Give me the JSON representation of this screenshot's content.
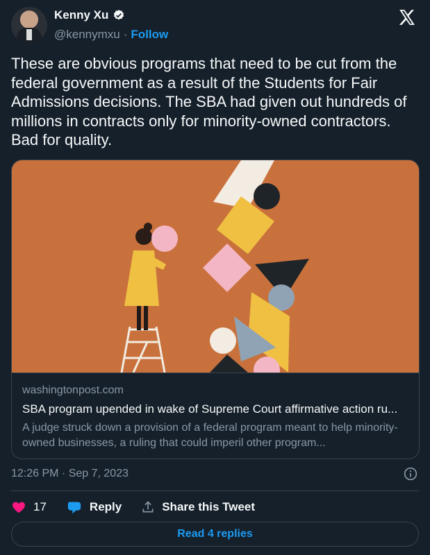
{
  "author": {
    "name": "Kenny Xu",
    "handle": "@kennymxu",
    "separator": "·",
    "follow_label": "Follow",
    "verified": true
  },
  "tweet_text": "These are obvious programs that need to be cut from the federal government as a result of the Students for Fair Admissions decisions.  The SBA had given out hundreds of millions in contracts only for minority-owned contractors.  Bad for quality.",
  "link_card": {
    "domain": "washingtonpost.com",
    "title": "SBA program upended in wake of Supreme Court affirmative action ru...",
    "description": "A judge struck down a provision of a federal program meant to help minority-owned businesses, a ruling that could imperil other program..."
  },
  "timestamp": "12:26 PM · Sep 7, 2023",
  "actions": {
    "like_count": "17",
    "reply_label": "Reply",
    "share_label": "Share this Tweet"
  },
  "read_replies_label": "Read 4 replies",
  "colors": {
    "background": "#15202b",
    "accent": "#1d9bf0",
    "like": "#f91880",
    "card_image_bg": "#c9713c"
  },
  "icons": [
    "verified-badge-icon",
    "x-logo-icon",
    "info-icon",
    "heart-icon",
    "reply-bubble-icon",
    "share-icon"
  ]
}
